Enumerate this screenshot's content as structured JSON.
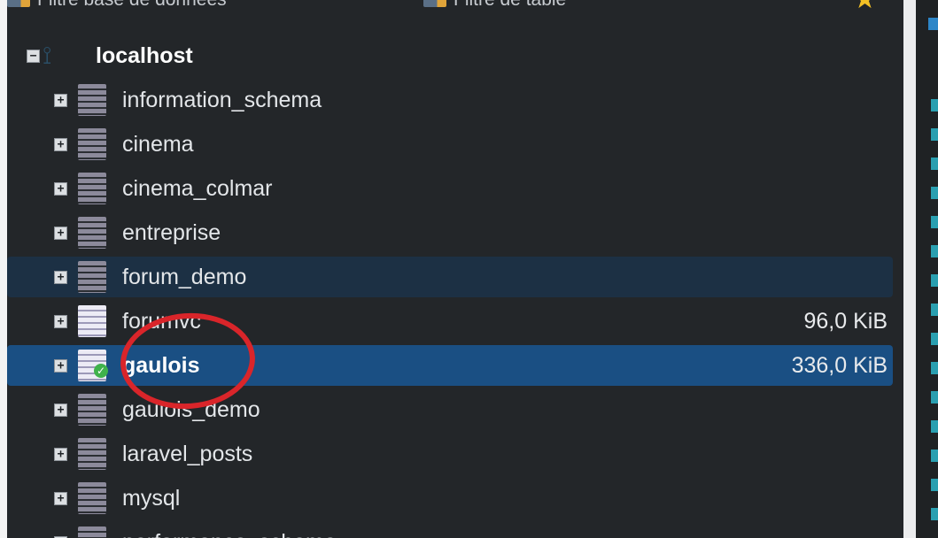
{
  "filters": {
    "database_filter_label": "Filtre base de données",
    "table_filter_label": "Filtre de table",
    "favorite_icon": "star-icon"
  },
  "tree": {
    "server": {
      "label": "localhost",
      "expander": "⊟",
      "icon": "server-icon"
    },
    "databases": [
      {
        "label": "information_schema",
        "size": "",
        "expander": "+"
      },
      {
        "label": "cinema",
        "size": "",
        "expander": "+"
      },
      {
        "label": "cinema_colmar",
        "size": "",
        "expander": "+"
      },
      {
        "label": "entreprise",
        "size": "",
        "expander": "+"
      },
      {
        "label": "forum_demo",
        "size": "",
        "expander": "+",
        "state": "hover"
      },
      {
        "label": "forumvc",
        "size": "96,0 KiB",
        "expander": "+"
      },
      {
        "label": "gaulois",
        "size": "336,0 KiB",
        "expander": "+",
        "state": "selected"
      },
      {
        "label": "gaulois_demo",
        "size": "",
        "expander": "+"
      },
      {
        "label": "laravel_posts",
        "size": "",
        "expander": "+"
      },
      {
        "label": "mysql",
        "size": "",
        "expander": "+"
      },
      {
        "label": "performance_schema",
        "size": "",
        "expander": "+"
      }
    ]
  },
  "colors": {
    "panel_background": "#232629",
    "selected_row": "#1a4f83",
    "hover_row": "#1c3044",
    "annotation_red": "#d9252a",
    "active_check": "#3fb24b"
  }
}
